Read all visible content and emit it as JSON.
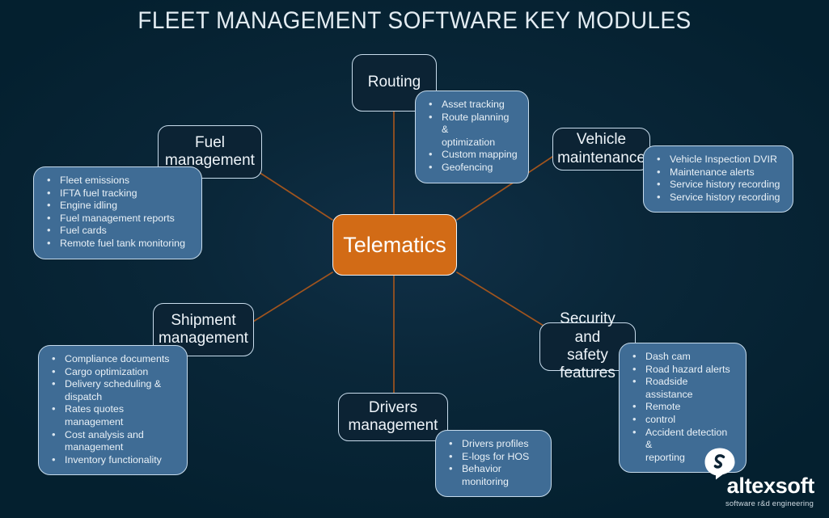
{
  "title": "FLEET MANAGEMENT SOFTWARE KEY MODULES",
  "center": {
    "label": "Telematics",
    "color": "#d26b16"
  },
  "theme": {
    "background": "#04202f",
    "node_fill": "#0c2334",
    "node_border": "#c8dcec",
    "panel_fill": "#3f6c95",
    "connector": "#a0541e",
    "text": "#eef4f9"
  },
  "modules": [
    {
      "id": "routing",
      "label": "Routing",
      "items": [
        "Asset tracking",
        "Route planning &\noptimization",
        "Custom mapping",
        "Geofencing"
      ]
    },
    {
      "id": "vehicle-maintenance",
      "label": "Vehicle\nmaintenance",
      "items": [
        "Vehicle Inspection DVIR",
        "Maintenance alerts",
        "Service history recording",
        "Service history recording"
      ]
    },
    {
      "id": "security-and-safety-features",
      "label": "Security and\nsafety\nfeatures",
      "items": [
        "Dash cam",
        "Road hazard alerts",
        "Roadside assistance",
        "Remote",
        " control",
        "Accident detection &\nreporting"
      ]
    },
    {
      "id": "drivers-management",
      "label": "Drivers\nmanagement",
      "items": [
        "Drivers profiles",
        "E-logs for HOS",
        "Behavior monitoring"
      ]
    },
    {
      "id": "shipment-management",
      "label": "Shipment\nmanagement",
      "items": [
        "Compliance documents",
        "Cargo optimization",
        "Delivery scheduling &\ndispatch",
        "Rates quotes\nmanagement",
        "Cost analysis and\nmanagement",
        "Inventory functionality"
      ]
    },
    {
      "id": "fuel-management",
      "label": "Fuel\nmanagement",
      "items": [
        "Fleet emissions",
        "IFTA fuel tracking",
        "Engine idling",
        "Fuel management reports",
        "Fuel cards",
        "Remote fuel tank monitoring"
      ]
    }
  ],
  "logo": {
    "name": "altexsoft",
    "tagline": "software r&d engineering"
  }
}
